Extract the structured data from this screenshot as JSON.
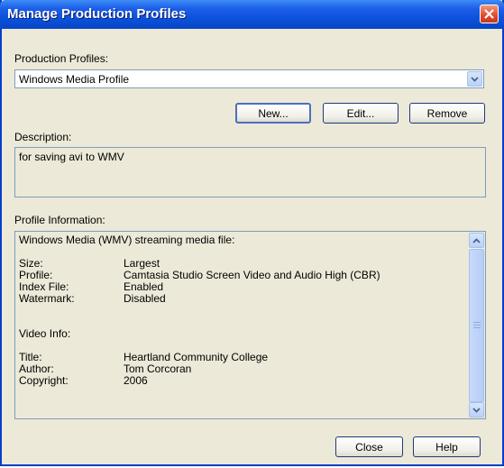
{
  "window": {
    "title": "Manage Production Profiles"
  },
  "profiles": {
    "label": "Production Profiles:",
    "selected": "Windows Media Profile",
    "buttons": {
      "new": "New...",
      "edit": "Edit...",
      "remove": "Remove"
    }
  },
  "description": {
    "label": "Description:",
    "text": "for saving avi to WMV"
  },
  "info": {
    "label": "Profile Information:",
    "header": "Windows Media (WMV) streaming media file:",
    "rows": [
      {
        "key": "Size:",
        "value": "Largest"
      },
      {
        "key": "Profile:",
        "value": "Camtasia Studio Screen Video and Audio High (CBR)"
      },
      {
        "key": "Index File:",
        "value": "Enabled"
      },
      {
        "key": "Watermark:",
        "value": "Disabled"
      }
    ],
    "video_header": "Video Info:",
    "video_rows": [
      {
        "key": "Title:",
        "value": "Heartland Community College"
      },
      {
        "key": "Author:",
        "value": "Tom Corcoran"
      },
      {
        "key": "Copyright:",
        "value": "2006"
      }
    ]
  },
  "footer": {
    "close": "Close",
    "help": "Help"
  },
  "icons": {
    "close": "close-icon",
    "dropdown": "chevron-down-icon",
    "scroll_up": "chevron-up-icon",
    "scroll_down": "chevron-down-icon"
  },
  "colors": {
    "titlebar": "#0a4fd8",
    "close": "#e2482a",
    "dialog_bg": "#ece9d8"
  }
}
